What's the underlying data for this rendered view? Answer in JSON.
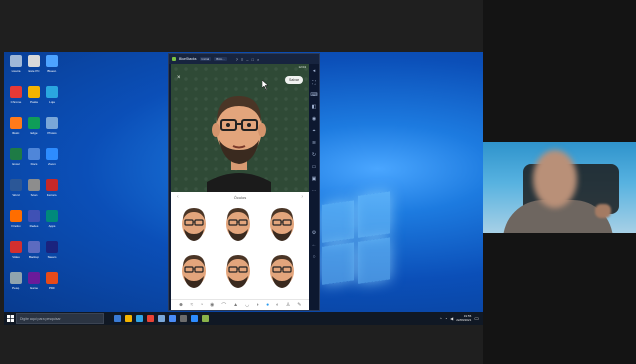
{
  "taskbar": {
    "search_placeholder": "Digite aqui para pesquisar",
    "clock_time": "19:55",
    "clock_date": "22/09/2021"
  },
  "bluestacks": {
    "title": "BlueStacks",
    "tabs": [
      "Inicial",
      "Bitm..."
    ]
  },
  "app": {
    "status_time": "12:04",
    "save_label": "Salvar",
    "sheet_title": "Óculos",
    "toolbar_icons": [
      "pose-icon",
      "hair-icon",
      "face-icon",
      "eyes-icon",
      "brow-icon",
      "nose-icon",
      "mouth-icon",
      "ear-icon",
      "glasses-icon",
      "hat-icon",
      "body-icon",
      "pen-icon"
    ]
  },
  "desktop_icons": [
    {
      "label": "Lixeira"
    },
    {
      "label": "Este PC"
    },
    {
      "label": "Bluest."
    },
    {
      "label": "Chrome"
    },
    {
      "label": "Pasta"
    },
    {
      "label": "Loja"
    },
    {
      "label": "Illustr."
    },
    {
      "label": "Edge"
    },
    {
      "label": "Photos"
    },
    {
      "label": "Excel"
    },
    {
      "label": "Docs"
    },
    {
      "label": "Zoom"
    },
    {
      "label": "Word"
    },
    {
      "label": "Scan"
    },
    {
      "label": "Ferram."
    },
    {
      "label": "Firefox"
    },
    {
      "label": "Redes"
    },
    {
      "label": "Apps"
    },
    {
      "label": "Video"
    },
    {
      "label": "Backup"
    },
    {
      "label": "Steam"
    },
    {
      "label": "Pesq."
    },
    {
      "label": "Game"
    },
    {
      "label": "PDF"
    }
  ],
  "colors": {
    "accent": "#1d7be0",
    "taskbar": "#101824",
    "bs_frame": "#0f1b33"
  }
}
